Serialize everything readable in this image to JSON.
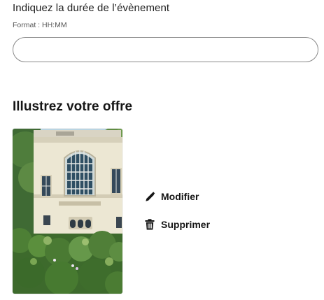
{
  "duration": {
    "label": "Indiquez la durée de l’évènement",
    "hint": "Format : HH:MM",
    "value": "",
    "placeholder": ""
  },
  "illustration": {
    "title": "Illustrez votre offre",
    "actions": {
      "edit_label": "Modifier",
      "edit_icon": "pencil-icon",
      "delete_label": "Supprimer",
      "delete_icon": "trash-icon"
    }
  },
  "colors": {
    "text": "#161616",
    "border": "#8a8a8a"
  }
}
